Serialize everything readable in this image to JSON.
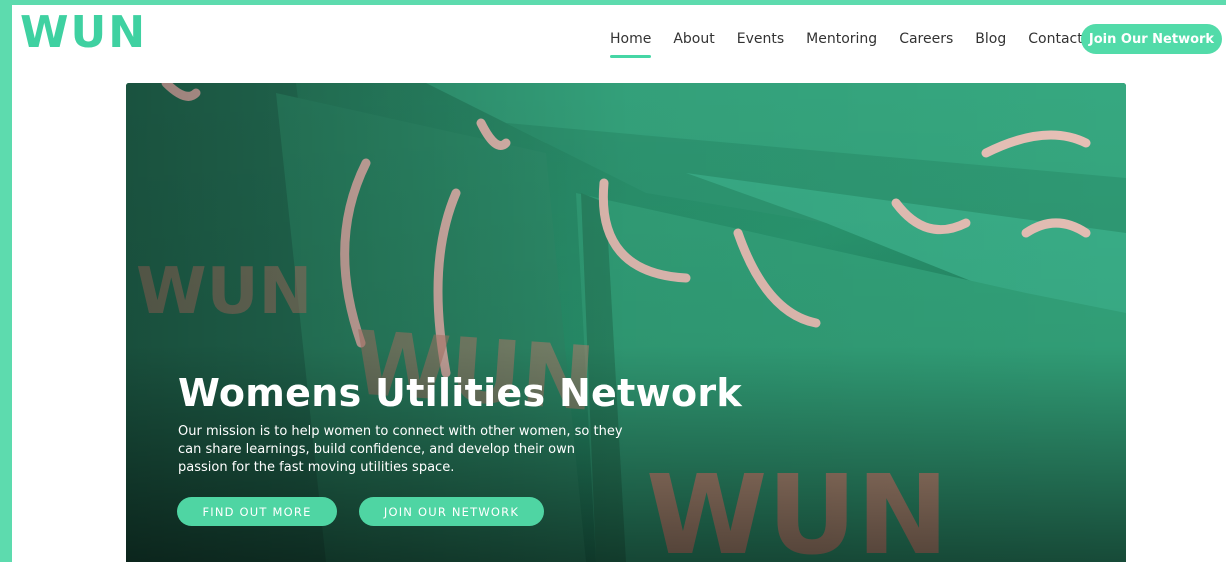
{
  "brand": {
    "logo": "WUN",
    "accent": "#5ddbae"
  },
  "nav": {
    "items": [
      "Home",
      "About",
      "Events",
      "Mentoring",
      "Careers",
      "Blog",
      "Contact"
    ],
    "active": "Home",
    "join_label": "Join Our Network"
  },
  "hero": {
    "title": "Womens Utilities Network",
    "text": "Our mission is to help women to connect with other women, so they can share learnings, build confidence, and develop their own passion for the fast moving utilities space.",
    "primary_cta": "FIND OUT MORE",
    "secondary_cta": "JOIN OUR NETWORK",
    "bag_print": "WUN"
  }
}
